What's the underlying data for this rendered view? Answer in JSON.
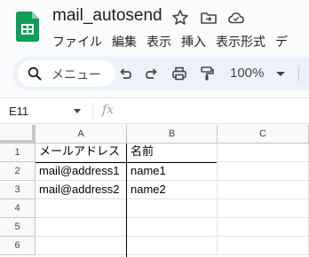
{
  "app": {
    "title": "mail_autosend",
    "brand_color": "#0f9d58",
    "title_icons": [
      "star-icon",
      "move-to-folder-icon",
      "cloud-saved-icon"
    ]
  },
  "menu": [
    "ファイル",
    "編集",
    "表示",
    "挿入",
    "表示形式",
    "デ"
  ],
  "toolbar": {
    "search_label": "メニュー",
    "icons": [
      "undo-icon",
      "redo-icon",
      "print-icon",
      "paint-format-icon"
    ],
    "zoom": "100%"
  },
  "formula_bar": {
    "name_box": "E11",
    "fx_label": "fx",
    "formula": ""
  },
  "grid": {
    "columns": [
      "A",
      "B",
      "C"
    ],
    "rows": [
      "1",
      "2",
      "3",
      "4",
      "5",
      "6"
    ],
    "cells": [
      [
        "メールアドレス",
        "名前",
        ""
      ],
      [
        "mail@address1",
        "name1",
        ""
      ],
      [
        "mail@address2",
        "name2",
        ""
      ],
      [
        "",
        "",
        ""
      ],
      [
        "",
        "",
        ""
      ],
      [
        "",
        "",
        ""
      ]
    ]
  }
}
